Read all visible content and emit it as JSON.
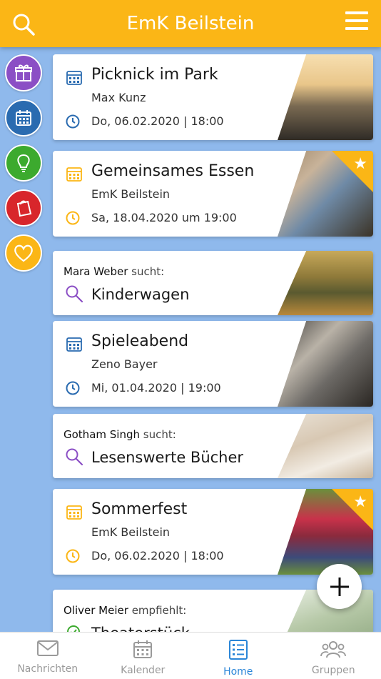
{
  "header": {
    "title": "EmK Beilstein"
  },
  "colors": {
    "header": "#fbb616",
    "background": "#8fb9ec",
    "blue": "#2a6bb0",
    "yellow": "#fbb616",
    "purple": "#8b4fc5",
    "active_tab": "#2a86d8"
  },
  "rail": [
    {
      "icon": "gift-icon",
      "color": "#8b4fc5"
    },
    {
      "icon": "calendar-icon",
      "color": "#2a6bb0"
    },
    {
      "icon": "lightbulb-icon",
      "color": "#3caa2e"
    },
    {
      "icon": "bag-icon",
      "color": "#d8262b"
    },
    {
      "icon": "heart-icon",
      "color": "#fbb616"
    }
  ],
  "cards": {
    "c1": {
      "title": "Picknick im Park",
      "org": "Max Kunz",
      "date": "Do, 06.02.2020 | 18:00"
    },
    "c2": {
      "title": "Gemeinsames Essen",
      "org": "EmK Beilstein",
      "date": "Sa, 18.04.2020 um 19:00"
    },
    "c3": {
      "person": "Mara Weber",
      "verb": "sucht:",
      "title": "Kinderwagen"
    },
    "c4": {
      "title": "Spieleabend",
      "org": "Zeno Bayer",
      "date": "Mi, 01.04.2020 | 19:00"
    },
    "c5": {
      "person": "Gotham Singh",
      "verb": "sucht:",
      "title": "Lesenswerte Bücher"
    },
    "c6": {
      "title": "Sommerfest",
      "org": "EmK Beilstein",
      "date": "Do, 06.02.2020 | 18:00"
    },
    "c7": {
      "person": "Oliver Meier",
      "verb": "empfiehlt:",
      "title": "Theaterstück"
    }
  },
  "tabs": [
    {
      "label": "Nachrichten",
      "icon": "mail-icon"
    },
    {
      "label": "Kalender",
      "icon": "calendar-icon"
    },
    {
      "label": "Home",
      "icon": "list-icon"
    },
    {
      "label": "Gruppen",
      "icon": "group-icon"
    }
  ]
}
